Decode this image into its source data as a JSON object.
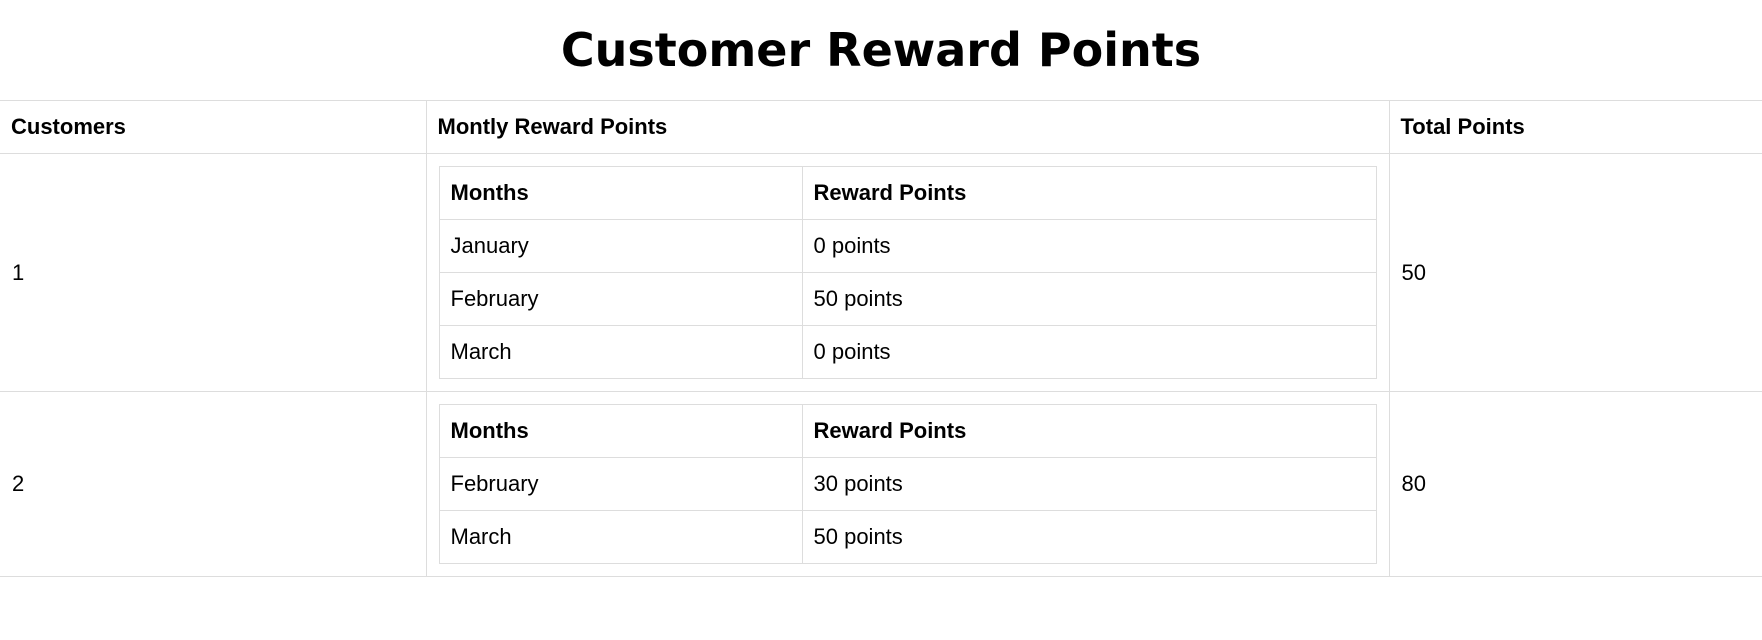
{
  "page": {
    "title": "Customer Reward Points"
  },
  "table": {
    "headers": {
      "customers": "Customers",
      "monthly": "Montly Reward Points",
      "total": "Total Points"
    },
    "inner_headers": {
      "months": "Months",
      "points": "Reward Points"
    },
    "rows": [
      {
        "customer": "1",
        "months": [
          {
            "month": "January",
            "points": "0 points"
          },
          {
            "month": "February",
            "points": "50 points"
          },
          {
            "month": "March",
            "points": "0 points"
          }
        ],
        "total": "50"
      },
      {
        "customer": "2",
        "months": [
          {
            "month": "February",
            "points": "30 points"
          },
          {
            "month": "March",
            "points": "50 points"
          }
        ],
        "total": "80"
      }
    ]
  }
}
